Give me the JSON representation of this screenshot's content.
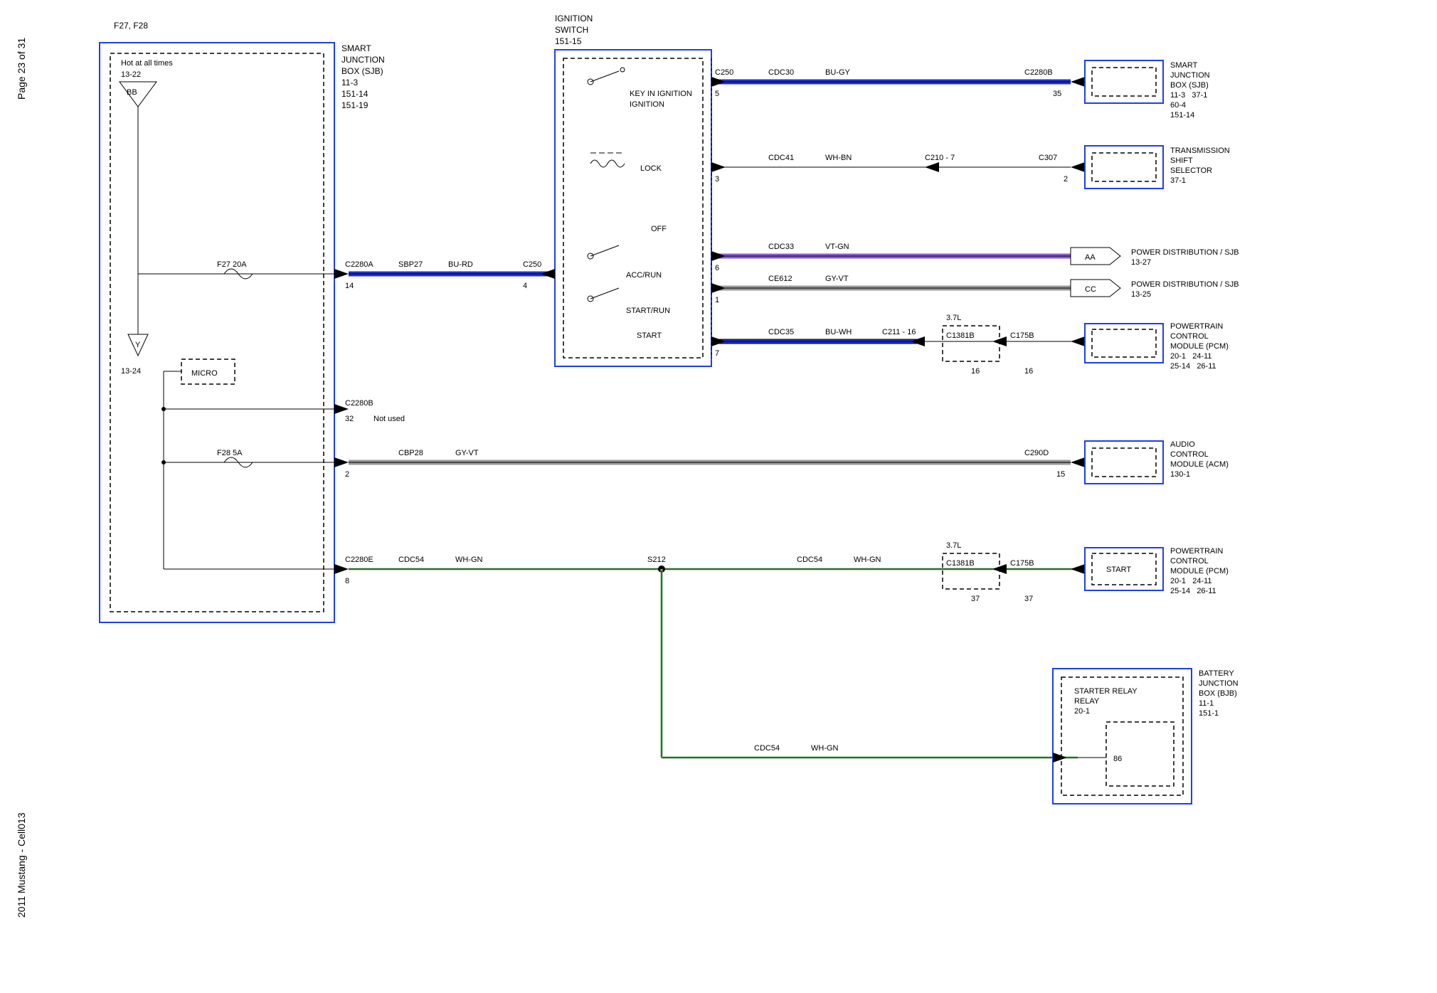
{
  "page": {
    "left": "2011 Mustang - Cell013",
    "right": "Page 23 of 31"
  },
  "title": "F27, F28",
  "sjb_left": {
    "name": "SMART JUNCTION BOX (SJB)",
    "refs": [
      "11-3",
      "151-14",
      "151-19"
    ],
    "hot": "Hot at all times",
    "hot_ref": "13-22",
    "bb": "BB",
    "y_ref": "13-24",
    "f27": "F27   20A",
    "f28": "F28    5A",
    "micro": "MICRO"
  },
  "ign": {
    "name": "IGNITION SWITCH",
    "ref": "151-15",
    "key": "KEY IN IGNITION",
    "lock": "LOCK",
    "off": "OFF",
    "acc": "ACC/RUN",
    "startrun": "START/RUN",
    "start": "START"
  },
  "conn": {
    "c2280a": "C2280A",
    "c2280a_pin": "14",
    "sbp27": "SBP27",
    "bu_rd": "BU-RD",
    "c250": "C250",
    "c250_pin": "4",
    "c2280b_left": "C2280B",
    "c2280b_left_pin": "32",
    "not_used": "Not used",
    "cbp28": "CBP28",
    "gyvt": "GY-VT",
    "cbp28_pin": "2",
    "c290d": "C290D",
    "c290d_pin": "15",
    "c2280e": "C2280E",
    "c2280e_pin": "8",
    "cdc54": "CDC54",
    "whgn": "WH-GN",
    "s212": "S212",
    "c250r": "C250",
    "c250r_pin": "5",
    "cdc30": "CDC30",
    "bugy": "BU-GY",
    "c2280b": "C2280B",
    "c2280b_pin": "35",
    "cdc41": "CDC41",
    "whbn": "WH-BN",
    "c210": "C210",
    "c210_pin": "7",
    "c307": "C307",
    "c307_pin": "2",
    "pin3": "3",
    "cdc33": "CDC33",
    "vtgn": "VT-GN",
    "pin6": "6",
    "aa": "AA",
    "ce612": "CE612",
    "gyvt2": "GY-VT",
    "pin1": "1",
    "cc": "CC",
    "cdc35": "CDC35",
    "buwh": "BU-WH",
    "pin7": "7",
    "c211": "C211",
    "c211_pin": "16",
    "eng": "3.7L",
    "c1381b": "C1381B",
    "c1381b_pin": "16",
    "c175b": "C175B",
    "c175b_pin": "16",
    "c1381b2_pin": "37",
    "c175b2_pin": "37",
    "relay_pin": "86"
  },
  "right": {
    "sjb": {
      "name": "SMART JUNCTION BOX (SJB)",
      "refs": [
        "11-3",
        "37-1",
        "60-4",
        "151-14"
      ]
    },
    "tss": {
      "name": "TRANSMISSION SHIFT SELECTOR",
      "ref": "37-1"
    },
    "pd1": {
      "name": "POWER DISTRIBUTION / SJB",
      "ref": "13-27"
    },
    "pd2": {
      "name": "POWER DISTRIBUTION / SJB",
      "ref": "13-25"
    },
    "pcm": {
      "name": "POWERTRAIN CONTROL MODULE (PCM)",
      "refs": [
        "20-1",
        "24-11",
        "25-14",
        "26-11"
      ]
    },
    "acm": {
      "name": "AUDIO CONTROL MODULE (ACM)",
      "ref": "130-1"
    },
    "pcm2": {
      "name": "POWERTRAIN CONTROL MODULE (PCM)",
      "refs": [
        "20-1",
        "24-11",
        "25-14",
        "26-11"
      ],
      "start": "START"
    },
    "bjb": {
      "name": "BATTERY JUNCTION BOX (BJB)",
      "refs": [
        "11-1",
        "151-1"
      ],
      "relay": "STARTER RELAY",
      "relay_ref": "20-1"
    }
  }
}
